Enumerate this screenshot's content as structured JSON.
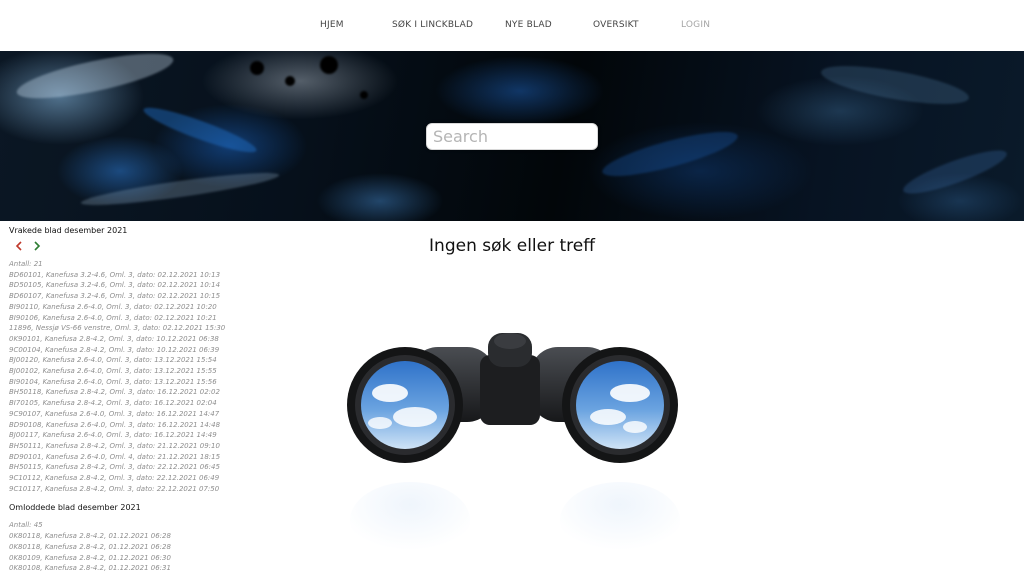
{
  "nav": {
    "items": [
      {
        "label": "HJEM"
      },
      {
        "label": "SØK I LINCKBLAD"
      },
      {
        "label": "NYE BLAD"
      },
      {
        "label": "OVERSIKT"
      },
      {
        "label": "LOGIN"
      }
    ]
  },
  "search": {
    "placeholder": "Search",
    "value": ""
  },
  "main": {
    "heading": "Ingen søk eller treff"
  },
  "sidebar": {
    "scrapped": {
      "title": "Vrakede blad desember 2021",
      "count": "Antall: 21",
      "prev_icon": "chevron-left-icon",
      "next_icon": "chevron-right-icon",
      "items": [
        "BD60101, Kanefusa 3.2-4.6, Oml. 3, dato: 02.12.2021 10:13",
        "BD50105, Kanefusa 3.2-4.6, Oml. 3, dato: 02.12.2021 10:14",
        "BD60107, Kanefusa 3.2-4.6, Oml. 3, dato: 02.12.2021 10:15",
        "BI90110, Kanefusa 2.6-4.0, Oml. 3, dato: 02.12.2021 10:20",
        "BI90106, Kanefusa 2.6-4.0, Oml. 3, dato: 02.12.2021 10:21",
        "11896, Nessjø VS-66 venstre, Oml. 3, dato: 02.12.2021 15:30",
        "0K90101, Kanefusa 2.8-4.2, Oml. 3, dato: 10.12.2021 06:38",
        "9C00104, Kanefusa 2.8-4.2, Oml. 3, dato: 10.12.2021 06:39",
        "BJ00120, Kanefusa 2.6-4.0, Oml. 3, dato: 13.12.2021 15:54",
        "BJ00102, Kanefusa 2.6-4.0, Oml. 3, dato: 13.12.2021 15:55",
        "BI90104, Kanefusa 2.6-4.0, Oml. 3, dato: 13.12.2021 15:56",
        "BH50118, Kanefusa 2.8-4.2, Oml. 3, dato: 16.12.2021 02:02",
        "BI70105, Kanefusa 2.8-4.2, Oml. 3, dato: 16.12.2021 02:04",
        "9C90107, Kanefusa 2.6-4.0, Oml. 3, dato: 16.12.2021 14:47",
        "BD90108, Kanefusa 2.6-4.0, Oml. 3, dato: 16.12.2021 14:48",
        "BJ00117, Kanefusa 2.6-4.0, Oml. 3, dato: 16.12.2021 14:49",
        "BH50111, Kanefusa 2.8-4.2, Oml. 3, dato: 21.12.2021 09:10",
        "BD90101, Kanefusa 2.6-4.0, Oml. 4, dato: 21.12.2021 18:15",
        "BH50115, Kanefusa 2.8-4.2, Oml. 3, dato: 22.12.2021 06:45",
        "9C10112, Kanefusa 2.8-4.2, Oml. 3, dato: 22.12.2021 06:49",
        "9C10117, Kanefusa 2.8-4.2, Oml. 3, dato: 22.12.2021 07:50"
      ]
    },
    "resharpened": {
      "title": "Omloddede blad desember 2021",
      "count": "Antall: 45",
      "items": [
        "0K80118, Kanefusa 2.8-4.2, 01.12.2021 06:28",
        "0K80118, Kanefusa 2.8-4.2, 01.12.2021 06:28",
        "0K80109, Kanefusa 2.8-4.2, 01.12.2021 06:30",
        "0K80108, Kanefusa 2.8-4.2, 01.12.2021 06:31"
      ]
    }
  },
  "image": {
    "icon": "binoculars-image"
  },
  "colors": {
    "prev_arrow": "#c0392b",
    "next_arrow": "#2e7d32",
    "entry_text": "#8e8e8e",
    "login_muted": "#a6a6a6"
  }
}
